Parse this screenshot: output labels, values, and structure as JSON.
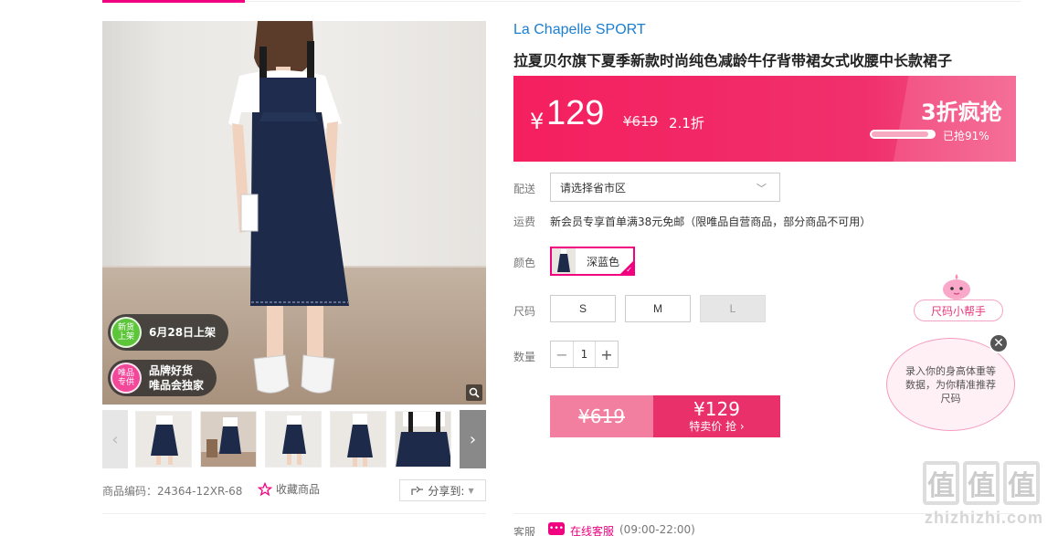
{
  "product": {
    "brand": "La Chapelle SPORT",
    "title": "拉夏贝尔旗下夏季新款时尚纯色减龄牛仔背带裙女式收腰中长款裙子"
  },
  "image_tags": [
    {
      "badge": "新货\n上架",
      "text": "6月28日上架",
      "color": "#5cc53a"
    },
    {
      "badge": "唯品\n专供",
      "text": "品牌好货\n唯品会独家",
      "color": "#f3479a"
    }
  ],
  "gallery": {
    "prev_icon": "‹",
    "next_icon": "›",
    "thumb_count": 6
  },
  "meta": {
    "code_label": "商品编码：24364-12XR-68",
    "favorite_label": "收藏商品",
    "share_label": "分享到:"
  },
  "price": {
    "currency": "¥",
    "sale": "129",
    "original": "¥619",
    "discount": "2.1折",
    "promo_title": "3折疯抢",
    "progress_fraction": 0.91,
    "progress_text": "已抢91%"
  },
  "delivery": {
    "label": "配送",
    "placeholder": "请选择省市区"
  },
  "shipping": {
    "label": "运费",
    "text": "新会员专享首单满38元免邮（限唯品自营商品，部分商品不可用）"
  },
  "color": {
    "label": "颜色",
    "selected": "深蓝色"
  },
  "size": {
    "label": "尺码",
    "options": [
      "S",
      "M",
      "L"
    ]
  },
  "quantity": {
    "label": "数量",
    "minus": "−",
    "value": "1",
    "plus": "+"
  },
  "buy": {
    "original": "¥619",
    "price": "¥129",
    "label": "特卖价 抢 ›"
  },
  "service": {
    "label": "客服",
    "link": "在线客服",
    "hours": "(09:00-22:00)"
  },
  "helper": {
    "title": "尺码小帮手",
    "text": "录入你的身高体重等数据，为你精准推荐尺码",
    "close": "✕"
  },
  "watermark": {
    "glyph": "值",
    "text": "zhizhizhi.com"
  },
  "colors": {
    "accent": "#f10180",
    "brand_blue": "#1a7ed1",
    "price_bar": "#f51f5f"
  }
}
